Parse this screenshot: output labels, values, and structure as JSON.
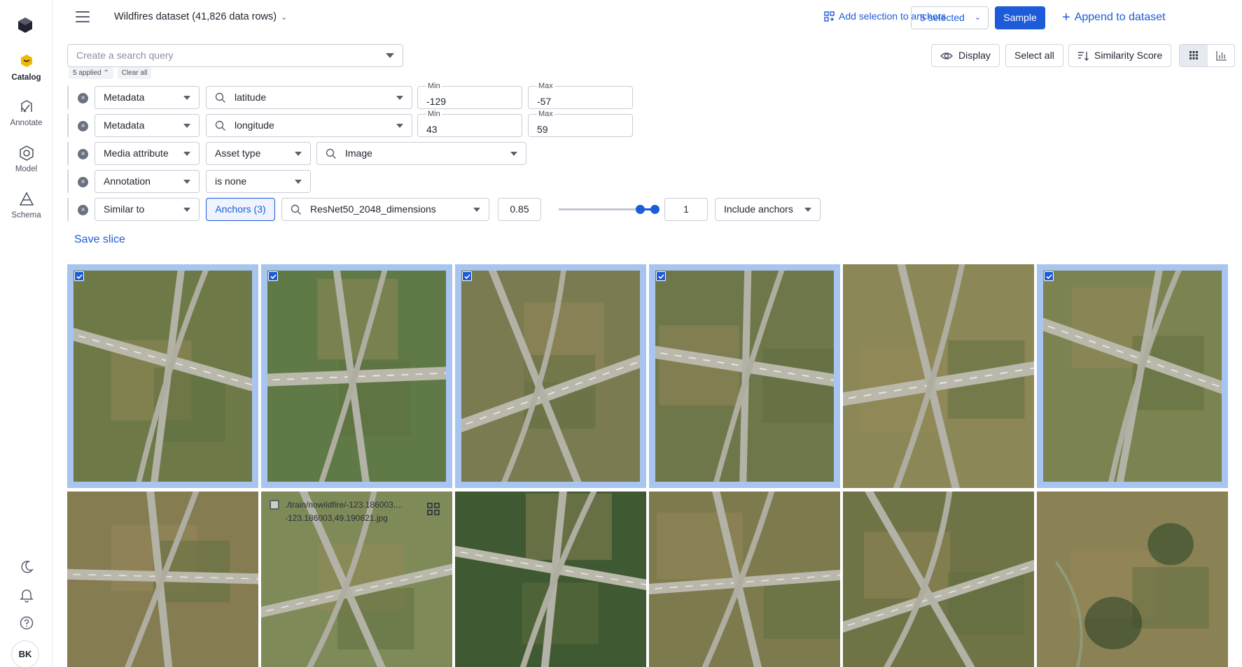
{
  "rail": {
    "items": [
      {
        "label": "Catalog",
        "icon": "catalog-icon"
      },
      {
        "label": "Annotate",
        "icon": "annotate-icon"
      },
      {
        "label": "Model",
        "icon": "model-icon"
      },
      {
        "label": "Schema",
        "icon": "schema-icon"
      }
    ],
    "avatar": "BK"
  },
  "topbar": {
    "dataset_title": "Wildfires dataset (41,826 data rows)",
    "add_selection": "Add selection to anchors",
    "selected": "5 selected",
    "sample": "Sample",
    "append": "Append to dataset"
  },
  "search": {
    "placeholder": "Create a search query",
    "applied": "5 applied",
    "clear_all": "Clear all"
  },
  "tools": {
    "display": "Display",
    "select_all": "Select all",
    "similarity": "Similarity Score"
  },
  "filters": [
    {
      "type": "Metadata",
      "field": "latitude",
      "min_label": "Min",
      "min": "-129",
      "max_label": "Max",
      "max": "-57"
    },
    {
      "type": "Metadata",
      "field": "longitude",
      "min_label": "Min",
      "min": "43",
      "max_label": "Max",
      "max": "59"
    },
    {
      "type": "Media attribute",
      "field": "Asset type",
      "value": "Image"
    },
    {
      "type": "Annotation",
      "field": "is none"
    },
    {
      "type": "Similar to",
      "anchors": "Anchors (3)",
      "embedding": "ResNet50_2048_dimensions",
      "low": "0.85",
      "high": "1",
      "include": "Include anchors"
    }
  ],
  "similarity_range": {
    "low": 0.85,
    "high": 1
  },
  "save_slice": "Save slice",
  "hover_file": {
    "line1": "./train/nowildfire/-123.186003,...",
    "line2": "-123.186003,49.190621.jpg"
  },
  "colors": {
    "accent": "#1d5bd8",
    "selected_border": "#a8c5f0"
  }
}
